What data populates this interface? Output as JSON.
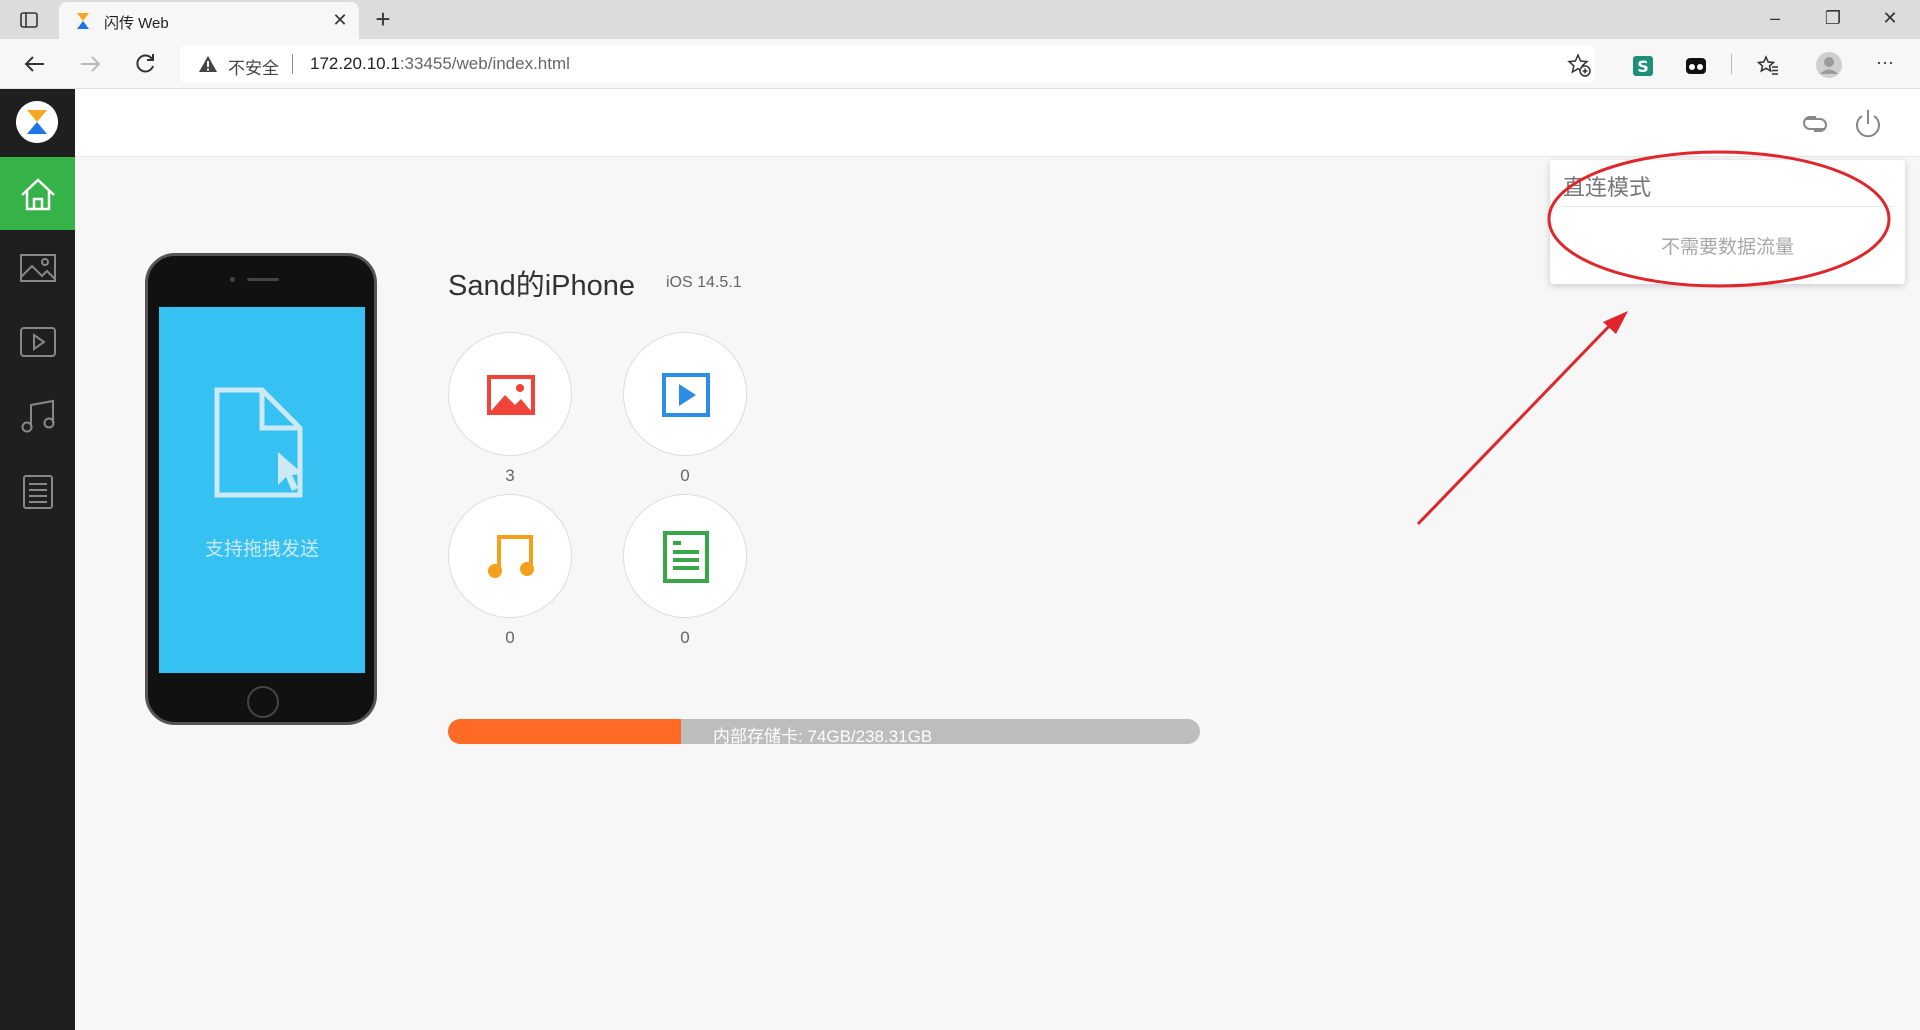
{
  "browser": {
    "tab_title": "闪传 Web",
    "tab_close": "✕",
    "new_tab": "+",
    "insecure_label": "不安全",
    "url_host": "172.20.10.1",
    "url_rest": ":33455/web/index.html",
    "minimize": "–",
    "restore": "❐",
    "close": "✕",
    "more": "···"
  },
  "dropdown": {
    "title": "直连模式",
    "text": "不需要数据流量"
  },
  "phone": {
    "drop_hint": "支持拖拽发送"
  },
  "device": {
    "name": "Sand的iPhone",
    "os": "iOS 14.5.1"
  },
  "categories": [
    {
      "name": "photos",
      "count": "3",
      "color": "#f0443a"
    },
    {
      "name": "videos",
      "count": "0",
      "color": "#2c8ee8"
    },
    {
      "name": "music",
      "count": "0",
      "color": "#f4a01b"
    },
    {
      "name": "documents",
      "count": "0",
      "color": "#3aa64a"
    }
  ],
  "storage": {
    "label": "内部存储卡: 74GB/238.31GB",
    "used_fraction": 0.31,
    "fill_color": "#ff6a26",
    "track_color": "#bdbdbd"
  },
  "colors": {
    "sidebar": "#1f1f1f",
    "active_nav": "#36b348",
    "annotation": "#e0262b"
  }
}
